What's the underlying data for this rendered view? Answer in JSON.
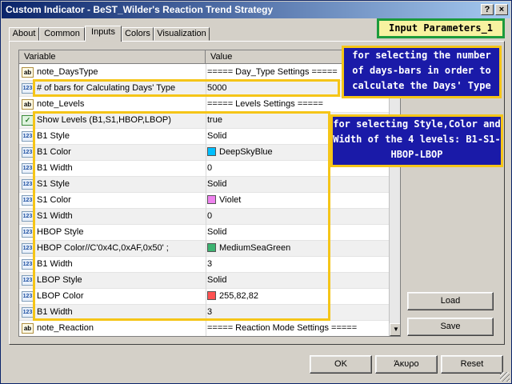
{
  "window": {
    "title": "Custom Indicator - BeST_Wilder's Reaction Trend Strategy",
    "help_label": "?",
    "close_label": "×"
  },
  "tabs": [
    {
      "label": "About"
    },
    {
      "label": "Common"
    },
    {
      "label": "Inputs"
    },
    {
      "label": "Colors"
    },
    {
      "label": "Visualization"
    }
  ],
  "active_tab": "Inputs",
  "grid": {
    "col_variable": "Variable",
    "col_value": "Value",
    "rows": [
      {
        "icon": "ab",
        "variable": "note_DaysType",
        "value": "===== Day_Type Settings ====="
      },
      {
        "icon": "123",
        "variable": "# of bars for Calculating Days' Type",
        "value": "5000"
      },
      {
        "icon": "ab",
        "variable": "note_Levels",
        "value": "===== Levels Settings ====="
      },
      {
        "icon": "check",
        "variable": "Show Levels (B1,S1,HBOP,LBOP)",
        "value": "true"
      },
      {
        "icon": "123",
        "variable": "B1 Style",
        "value": "Solid"
      },
      {
        "icon": "123",
        "variable": "B1 Color",
        "value": "DeepSkyBlue",
        "swatch": "#00bfff"
      },
      {
        "icon": "123",
        "variable": "B1 Width",
        "value": "0"
      },
      {
        "icon": "123",
        "variable": "S1 Style",
        "value": "Solid"
      },
      {
        "icon": "123",
        "variable": "S1 Color",
        "value": "Violet",
        "swatch": "#ee82ee"
      },
      {
        "icon": "123",
        "variable": "S1 Width",
        "value": "0"
      },
      {
        "icon": "123",
        "variable": "HBOP Style",
        "value": "Solid"
      },
      {
        "icon": "123",
        "variable": "HBOP Color//C'0x4C,0xAF,0x50' ;",
        "value": "MediumSeaGreen",
        "swatch": "#3cb371"
      },
      {
        "icon": "123",
        "variable": "B1 Width",
        "value": "3"
      },
      {
        "icon": "123",
        "variable": "LBOP Style",
        "value": "Solid"
      },
      {
        "icon": "123",
        "variable": "LBOP Color",
        "value": "255,82,82",
        "swatch": "#ff5252"
      },
      {
        "icon": "123",
        "variable": "B1 Width",
        "value": "3"
      },
      {
        "icon": "ab",
        "variable": "note_Reaction",
        "value": "===== Reaction Mode Settings ====="
      }
    ]
  },
  "side_buttons": {
    "load": "Load",
    "save": "Save"
  },
  "footer_buttons": {
    "ok": "OK",
    "cancel": "Άκυρο",
    "reset": "Reset"
  },
  "annotations": {
    "input_params": "Input Parameters_1",
    "days_note": "for selecting the number of days-bars in order to calculate the Days' Type",
    "levels_note": "for selecting Style,Color and Width of the 4 levels: B1-S1-HBOP-LBOP"
  },
  "colors": {
    "annotation_bg": "#1a1aa8",
    "annotation_border": "#f5c518",
    "params_border": "#1c9b3c",
    "title_gradient_start": "#0a246a"
  },
  "icons": {
    "ab": "string-param-icon",
    "123": "number-param-icon",
    "check": "bool-param-icon"
  }
}
